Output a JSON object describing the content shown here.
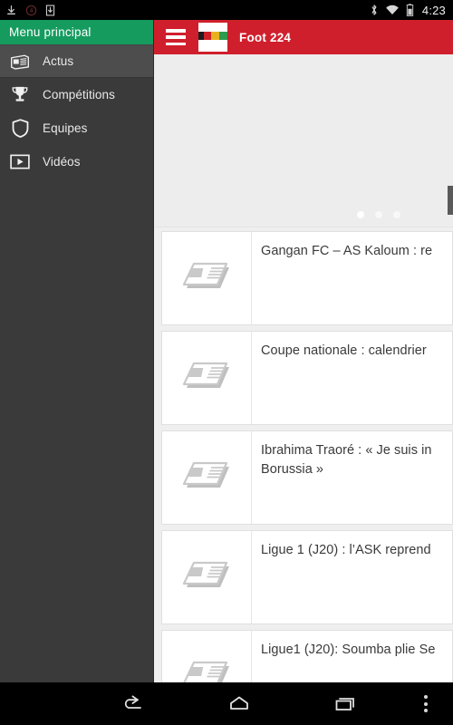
{
  "statusbar": {
    "time": "4:23",
    "left_icons": [
      "download-icon",
      "download-count-icon",
      "save-to-device-icon"
    ],
    "right_icons": [
      "bluetooth-icon",
      "wifi-icon",
      "battery-icon"
    ]
  },
  "drawer": {
    "header_title": "Menu principal",
    "background_color": "#3a3a3a",
    "header_color": "#169b5f",
    "items": [
      {
        "label": "Actus",
        "icon": "newspaper-icon",
        "selected": true
      },
      {
        "label": "Compétitions",
        "icon": "trophy-icon",
        "selected": false
      },
      {
        "label": "Equipes",
        "icon": "shield-icon",
        "selected": false
      },
      {
        "label": "Vidéos",
        "icon": "video-play-icon",
        "selected": false
      }
    ]
  },
  "appbar": {
    "title": "Foot 224",
    "menu_icon": "hamburger-menu-icon",
    "logo_icon": "app-logo-icon",
    "background_color": "#d01f2c",
    "logo_band_colors": [
      "#1d1d1d",
      "#cf2027",
      "#e8b21f",
      "#2e9b4e"
    ]
  },
  "carousel": {
    "dots": 3,
    "active_dot_index": 0
  },
  "news": {
    "items": [
      {
        "title": "Gangan FC – AS Kaloum : re",
        "icon": "newspaper-placeholder-icon"
      },
      {
        "title": "Coupe nationale : calendrier",
        "icon": "newspaper-placeholder-icon"
      },
      {
        "title": "Ibrahima Traoré : « Je suis in\nBorussia »",
        "icon": "newspaper-placeholder-icon"
      },
      {
        "title": "Ligue 1 (J20) : l’ASK reprend",
        "icon": "newspaper-placeholder-icon"
      },
      {
        "title": "Ligue1 (J20): Soumba plie Se",
        "icon": "newspaper-placeholder-icon"
      }
    ]
  },
  "navbar": {
    "buttons": [
      "back-button",
      "home-button",
      "recents-button",
      "overflow-menu-button"
    ]
  }
}
